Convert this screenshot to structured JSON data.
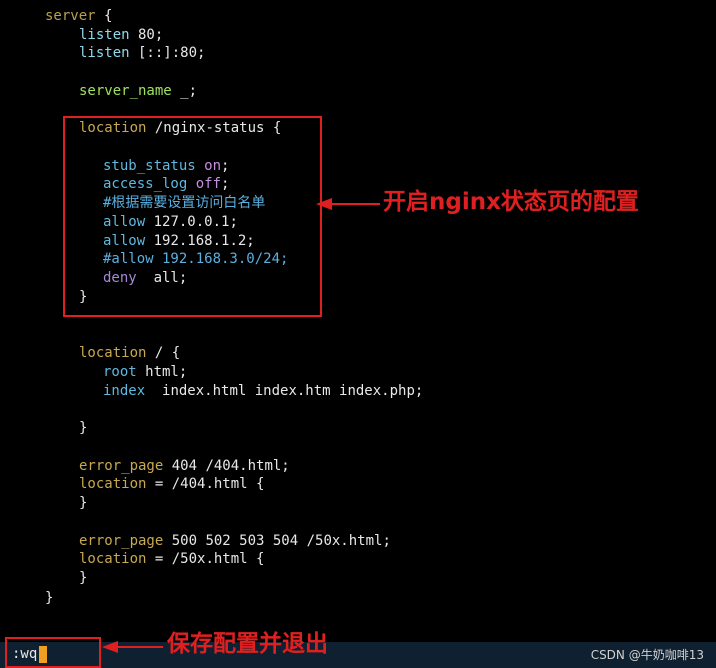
{
  "editor": {
    "lines": [
      {
        "parts": [
          {
            "t": "server",
            "c": "kw-server"
          },
          {
            "t": " {",
            "c": "plain"
          }
        ]
      },
      {
        "parts": [
          {
            "t": "listen",
            "c": "kw-listen"
          },
          {
            "t": " 80;",
            "c": "plain"
          }
        ]
      },
      {
        "parts": [
          {
            "t": "listen",
            "c": "kw-listen"
          },
          {
            "t": " [::]:80;",
            "c": "plain"
          }
        ]
      },
      {
        "parts": []
      },
      {
        "parts": [
          {
            "t": "server_name",
            "c": "kw-name"
          },
          {
            "t": " _;",
            "c": "plain"
          }
        ]
      },
      {
        "parts": []
      },
      {
        "parts": [
          {
            "t": "location",
            "c": "kw-loc"
          },
          {
            "t": " /nginx-status {",
            "c": "plain"
          }
        ]
      },
      {
        "parts": []
      },
      {
        "parts": [
          {
            "t": "stub_status",
            "c": "kw-stub"
          },
          {
            "t": " ",
            "c": "plain"
          },
          {
            "t": "on",
            "c": "kw-on"
          },
          {
            "t": ";",
            "c": "plain"
          }
        ]
      },
      {
        "parts": [
          {
            "t": "access_log",
            "c": "kw-stub"
          },
          {
            "t": " ",
            "c": "plain"
          },
          {
            "t": "off",
            "c": "kw-on"
          },
          {
            "t": ";",
            "c": "plain"
          }
        ]
      },
      {
        "parts": [
          {
            "t": "#根据需要设置访问白名单",
            "c": "kw-comment"
          }
        ]
      },
      {
        "parts": [
          {
            "t": "allow",
            "c": "kw-stub"
          },
          {
            "t": " 127.0.0.1;",
            "c": "plain"
          }
        ]
      },
      {
        "parts": [
          {
            "t": "allow",
            "c": "kw-stub"
          },
          {
            "t": " 192.168.1.2;",
            "c": "plain"
          }
        ]
      },
      {
        "parts": [
          {
            "t": "#allow 192.168.3.0/24;",
            "c": "kw-comment"
          }
        ]
      },
      {
        "parts": [
          {
            "t": "deny",
            "c": "kw-deny"
          },
          {
            "t": "  all;",
            "c": "plain"
          }
        ]
      },
      {
        "parts": [
          {
            "t": "}",
            "c": "plain"
          }
        ]
      },
      {
        "parts": []
      },
      {
        "parts": []
      },
      {
        "parts": [
          {
            "t": "location",
            "c": "kw-loc"
          },
          {
            "t": " / {",
            "c": "plain"
          }
        ]
      },
      {
        "parts": [
          {
            "t": "root",
            "c": "kw-stub"
          },
          {
            "t": " html;",
            "c": "plain"
          }
        ]
      },
      {
        "parts": [
          {
            "t": "index",
            "c": "kw-stub"
          },
          {
            "t": "  index.html index.htm index.php;",
            "c": "plain"
          }
        ]
      },
      {
        "parts": []
      },
      {
        "parts": [
          {
            "t": "}",
            "c": "plain"
          }
        ]
      },
      {
        "parts": []
      },
      {
        "parts": [
          {
            "t": "error_page",
            "c": "kw-err"
          },
          {
            "t": " 404 /404.html;",
            "c": "plain"
          }
        ]
      },
      {
        "parts": [
          {
            "t": "location",
            "c": "kw-loc"
          },
          {
            "t": " = /404.html {",
            "c": "plain"
          }
        ]
      },
      {
        "parts": [
          {
            "t": "}",
            "c": "plain"
          }
        ]
      },
      {
        "parts": []
      },
      {
        "parts": [
          {
            "t": "error_page",
            "c": "kw-err"
          },
          {
            "t": " 500 502 503 504 /50x.html;",
            "c": "plain"
          }
        ]
      },
      {
        "parts": [
          {
            "t": "location",
            "c": "kw-loc"
          },
          {
            "t": " = /50x.html {",
            "c": "plain"
          }
        ]
      },
      {
        "parts": [
          {
            "t": "}",
            "c": "plain"
          }
        ]
      },
      {
        "parts": [
          {
            "t": "}",
            "c": "plain"
          }
        ]
      }
    ]
  },
  "annotations": {
    "status_page_note": "开启nginx状态页的配置",
    "save_note": "保存配置并退出"
  },
  "command_line": ":wq",
  "watermark": "CSDN @牛奶咖啡13",
  "colors": {
    "background": "#000000",
    "annotation_red": "#e02020",
    "cursor": "#f0a020"
  }
}
